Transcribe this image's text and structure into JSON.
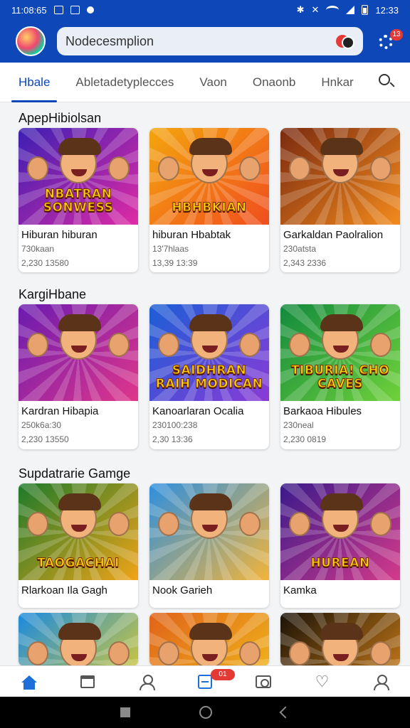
{
  "status_bar": {
    "time": "11:08:65",
    "clock": "12:33"
  },
  "header": {
    "search_placeholder": "Nodecesmplion",
    "notification_count": "13"
  },
  "tabs": [
    {
      "label": "Hbale",
      "active": true
    },
    {
      "label": "Abletadetyplecces",
      "active": false
    },
    {
      "label": "Vaon",
      "active": false
    },
    {
      "label": "Onaonb",
      "active": false
    },
    {
      "label": "Hnkar",
      "active": false
    }
  ],
  "sections": [
    {
      "title": "ApepHibiolsan",
      "cards": [
        {
          "thumb_text": "NBATRAN SONWESS",
          "bg": [
            "#3b1fb3",
            "#e02aa4"
          ],
          "title": "Hiburan hiburan",
          "meta1": "730kaan",
          "meta2": "2,230 13580"
        },
        {
          "thumb_text": "HBHBKIAN",
          "bg": [
            "#f3a50e",
            "#f04e1e"
          ],
          "title": "hiburan Hbabtak",
          "meta1": "13'7hlaas",
          "meta2": "13,39 13:39"
        },
        {
          "thumb_text": "",
          "bg": [
            "#7a2a10",
            "#f28a1c"
          ],
          "title": "Garkaldan Paolralion",
          "meta1": "230atsta",
          "meta2": "2,343 2336"
        }
      ]
    },
    {
      "title": "KargiHbane",
      "cards": [
        {
          "thumb_text": "",
          "bg": [
            "#6a1bb0",
            "#e0368a"
          ],
          "title": "Kardran Hibapia",
          "meta1": "250k6a:30",
          "meta2": "2,230 13550"
        },
        {
          "thumb_text": "SAIDHRAN RAIH MODICAN",
          "bg": [
            "#1b5fd6",
            "#8a3ad6"
          ],
          "title": "Kanoarlaran Ocalia",
          "meta1": "230100:238",
          "meta2": "2,30 13:36"
        },
        {
          "thumb_text": "TIBURIA! CHO CAVES",
          "bg": [
            "#128a3e",
            "#6fd13a"
          ],
          "title": "Barkaoa Hibules",
          "meta1": "230neal",
          "meta2": "2,230 0819"
        }
      ]
    },
    {
      "title": "Supdatrarie Gamge",
      "cards": [
        {
          "thumb_text": "TAOGACHAI",
          "bg": [
            "#1d7a2a",
            "#f0a418"
          ],
          "title": "Rlarkoan Ila Gagh",
          "meta1": "",
          "meta2": ""
        },
        {
          "thumb_text": "",
          "bg": [
            "#2d8fe0",
            "#f2b43a"
          ],
          "title": "Nook Garieh",
          "meta1": "",
          "meta2": ""
        },
        {
          "thumb_text": "HUREAN",
          "bg": [
            "#3a1a8a",
            "#d43a8a"
          ],
          "title": "Kamka",
          "meta1": "",
          "meta2": ""
        }
      ]
    },
    {
      "title": "",
      "cards": [
        {
          "thumb_text": "",
          "bg": [
            "#1a8ae0",
            "#f2d31a"
          ],
          "title": "",
          "meta1": "",
          "meta2": ""
        },
        {
          "thumb_text": "",
          "bg": [
            "#e0631a",
            "#f2c21a"
          ],
          "title": "",
          "meta1": "",
          "meta2": ""
        },
        {
          "thumb_text": "",
          "bg": [
            "#1a1208",
            "#e08a1a"
          ],
          "title": "",
          "meta1": "",
          "meta2": ""
        }
      ]
    }
  ],
  "bottom_nav": {
    "library_badge": "01"
  },
  "colors": {
    "primary": "#0d47b8",
    "accent": "#1e6fd9",
    "badge": "#e53935"
  }
}
